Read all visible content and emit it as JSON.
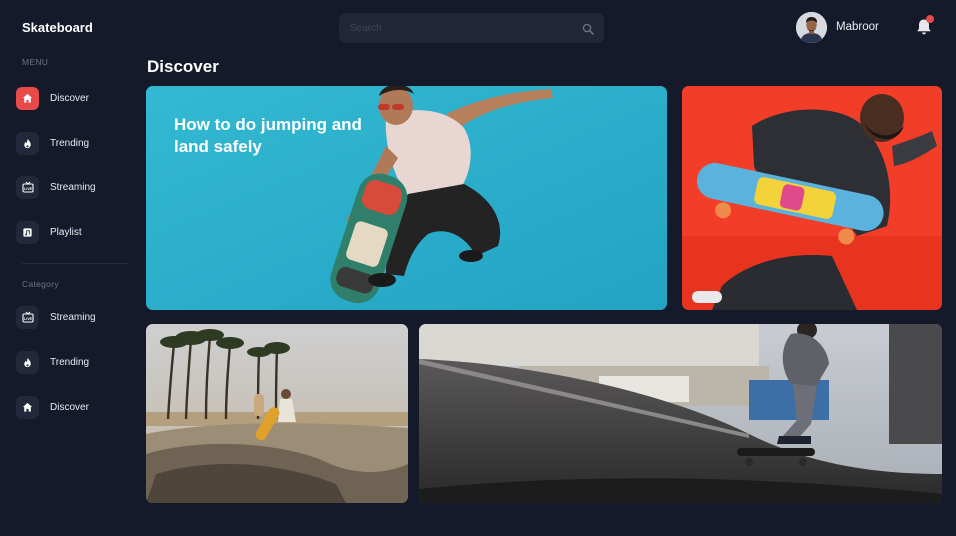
{
  "app": {
    "brand": "Skateboard"
  },
  "sidebar": {
    "menu_label": "MENU",
    "menu_items": [
      {
        "label": "Discover",
        "icon": "home-icon",
        "active": true
      },
      {
        "label": "Trending",
        "icon": "flame-icon",
        "active": false
      },
      {
        "label": "Streaming",
        "icon": "live-icon",
        "active": false
      },
      {
        "label": "Playlist",
        "icon": "playlist-icon",
        "active": false
      }
    ],
    "category_label": "Category",
    "category_items": [
      {
        "label": "Streaming",
        "icon": "live-icon"
      },
      {
        "label": "Trending",
        "icon": "flame-icon"
      },
      {
        "label": "Discover",
        "icon": "home-icon"
      }
    ]
  },
  "header": {
    "search_placeholder": "Search",
    "user_name": "Mabroor",
    "has_notification": true
  },
  "main": {
    "title": "Discover",
    "cards": [
      {
        "headline": "How to do jumping and land safely",
        "image": "skater-jumping-photo"
      },
      {
        "image": "skater-holding-board-photo"
      },
      {
        "image": "skatepark-beach-photo"
      },
      {
        "image": "skatepark-bowl-photo"
      }
    ]
  },
  "colors": {
    "background": "#151a2a",
    "accent": "#e84a4a",
    "icon_tile": "#222839",
    "search_bg": "#212738"
  }
}
